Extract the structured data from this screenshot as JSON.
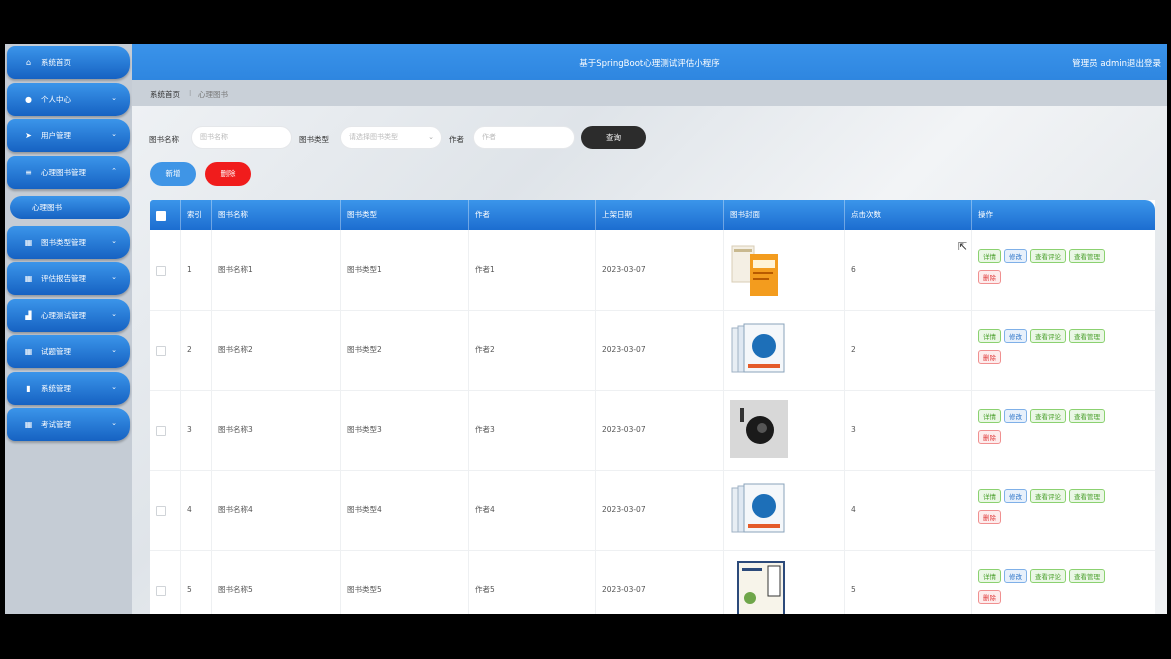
{
  "app": {
    "title": "基于SpringBoot心理测试评估小程序",
    "user_label": "管理员 admin",
    "logout": "退出登录"
  },
  "sidebar": {
    "items": [
      {
        "label": "系统首页",
        "icon": "home-icon",
        "glyph": "⌂"
      },
      {
        "label": "个人中心",
        "icon": "person-icon",
        "glyph": "●"
      },
      {
        "label": "用户管理",
        "icon": "send-icon",
        "glyph": "➤"
      },
      {
        "label": "心理图书管理",
        "icon": "sliders-icon",
        "glyph": "≡"
      },
      {
        "label": "图书类型管理",
        "icon": "grid-icon",
        "glyph": "▦"
      },
      {
        "label": "评估报告管理",
        "icon": "grid-icon",
        "glyph": "▦"
      },
      {
        "label": "心理测试管理",
        "icon": "chart-icon",
        "glyph": "▟"
      },
      {
        "label": "试题管理",
        "icon": "apps-icon",
        "glyph": "▦"
      },
      {
        "label": "系统管理",
        "icon": "bar-chart-icon",
        "glyph": "▮"
      },
      {
        "label": "考试管理",
        "icon": "apps-icon",
        "glyph": "▦"
      }
    ],
    "active_sub": "心理图书"
  },
  "breadcrumb": {
    "home": "系统首页",
    "separator": "⁝",
    "current": "心理图书"
  },
  "search": {
    "name_label": "图书名称",
    "name_placeholder": "图书名称",
    "type_label": "图书类型",
    "type_placeholder": "请选择图书类型",
    "author_label": "作者",
    "author_placeholder": "作者",
    "query_button": "查询"
  },
  "actions": {
    "add": "新增",
    "delete": "删除"
  },
  "table": {
    "columns": [
      "索引",
      "图书名称",
      "图书类型",
      "作者",
      "上架日期",
      "图书封面",
      "点击次数",
      "操作"
    ],
    "op_labels": {
      "detail": "详情",
      "edit": "修改",
      "comments": "查看评论",
      "rack": "查看评论",
      "manage": "查看管理",
      "delete": "删除"
    },
    "rows": [
      {
        "index": "1",
        "name": "图书名称1",
        "type": "图书类型1",
        "author": "作者1",
        "date": "2023-03-07",
        "clicks": "6"
      },
      {
        "index": "2",
        "name": "图书名称2",
        "type": "图书类型2",
        "author": "作者2",
        "date": "2023-03-07",
        "clicks": "2"
      },
      {
        "index": "3",
        "name": "图书名称3",
        "type": "图书类型3",
        "author": "作者3",
        "date": "2023-03-07",
        "clicks": "3"
      },
      {
        "index": "4",
        "name": "图书名称4",
        "type": "图书类型4",
        "author": "作者4",
        "date": "2023-03-07",
        "clicks": "4"
      },
      {
        "index": "5",
        "name": "图书名称5",
        "type": "图书类型5",
        "author": "作者5",
        "date": "2023-03-07",
        "clicks": "5"
      }
    ]
  },
  "colors": {
    "primary": "#2e86e0",
    "danger": "#f01c1c",
    "dark": "#2c2c2c"
  }
}
